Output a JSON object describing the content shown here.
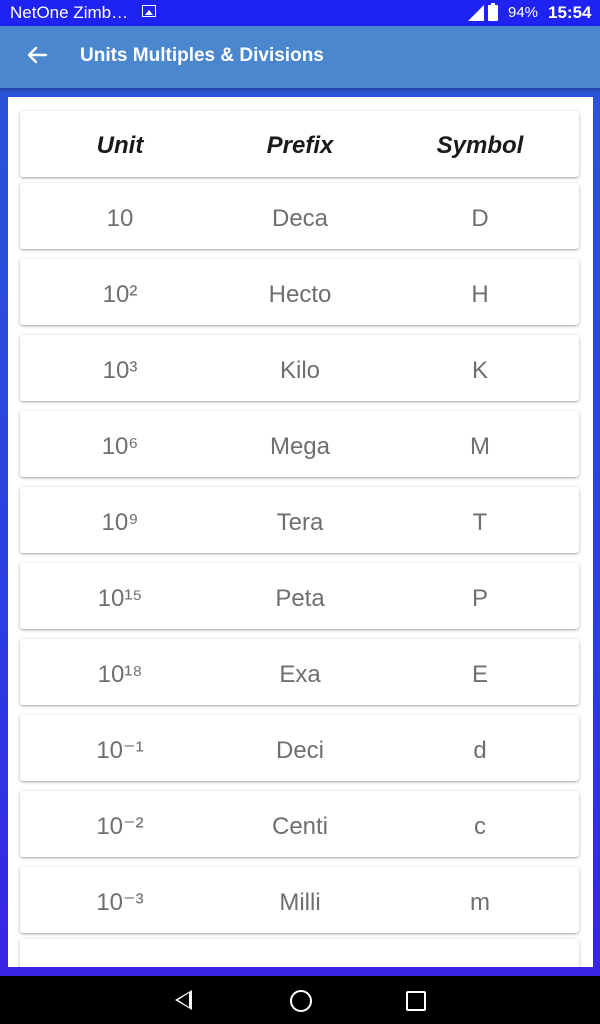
{
  "status_bar": {
    "carrier": "NetOne Zimb…",
    "battery": "94%",
    "time": "15:54",
    "icons": [
      "image-notification-icon",
      "signal-icon",
      "battery-icon"
    ]
  },
  "app_bar": {
    "title": "Units Multiples & Divisions",
    "back_icon": "arrow-left-icon"
  },
  "table": {
    "headers": [
      "Unit",
      "Prefix",
      "Symbol"
    ],
    "rows": [
      [
        "10",
        "Deca",
        "D"
      ],
      [
        "10²",
        "Hecto",
        "H"
      ],
      [
        "10³",
        "Kilo",
        "K"
      ],
      [
        "10⁶",
        "Mega",
        "M"
      ],
      [
        "10⁹",
        "Tera",
        "T"
      ],
      [
        "10¹⁵",
        "Peta",
        "P"
      ],
      [
        "10¹⁸",
        "Exa",
        "E"
      ],
      [
        "10⁻¹",
        "Deci",
        "d"
      ],
      [
        "10⁻²",
        "Centi",
        "c"
      ],
      [
        "10⁻³",
        "Milli",
        "m"
      ]
    ]
  },
  "nav_bar": {
    "icons": [
      "nav-back-icon",
      "nav-home-icon",
      "nav-recents-icon"
    ]
  },
  "colors": {
    "status_bar": "#1f23f2",
    "app_bar": "#4a87cf",
    "background": "#2a57d6",
    "header_text": "#1a1a1a",
    "cell_text": "#6f6f6f"
  }
}
